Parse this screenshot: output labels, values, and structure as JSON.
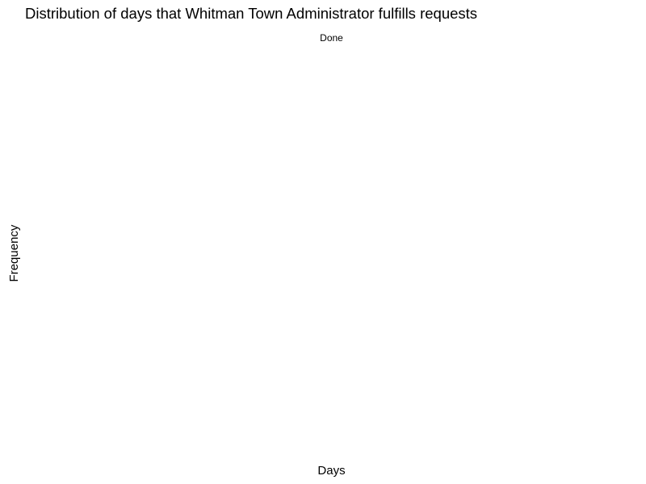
{
  "chart_data": {
    "type": "bar",
    "title": "Distribution of days that Whitman Town Administrator fulfills requests",
    "facets": [
      "Done"
    ],
    "xlabel": "Days",
    "ylabel": "Frequency",
    "grid": false,
    "series": [],
    "values": []
  }
}
